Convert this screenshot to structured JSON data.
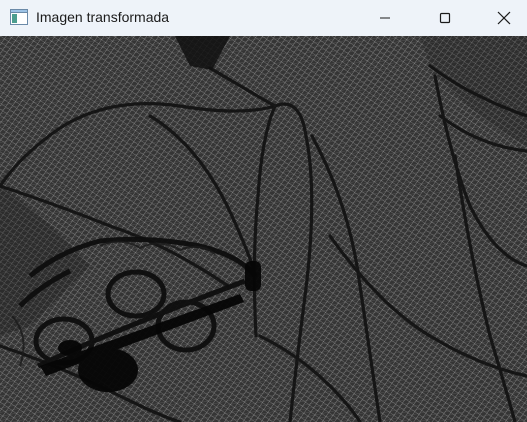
{
  "window": {
    "title": "Imagen transformada",
    "icons": {
      "app": "app-window-icon",
      "minimize": "minimize-icon",
      "maximize": "maximize-icon",
      "close": "close-icon"
    }
  },
  "image": {
    "description_icon": "transformed-image-canvas",
    "base_color": "#353535",
    "hatch_color": "#cfcfcf",
    "outline_color": "#111111"
  }
}
